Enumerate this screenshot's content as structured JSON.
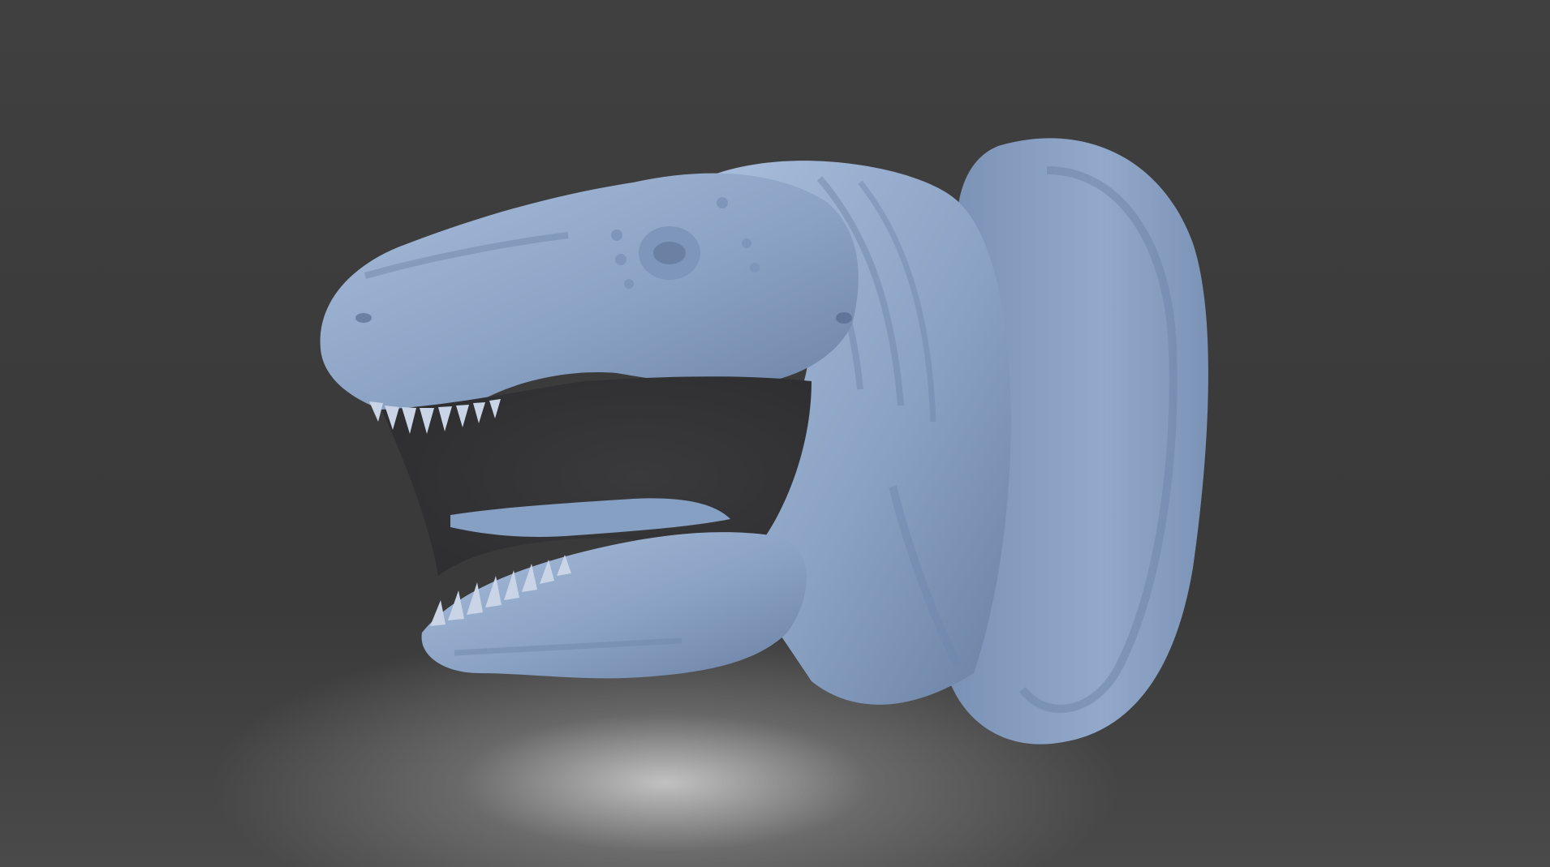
{
  "scene": {
    "background_color": "#3b3b3b",
    "floor_highlight_color": "#d7d7d7",
    "model_color": "#8aa2c4",
    "model_shadow_color": "#6a81a4",
    "model_highlight_color": "#a9bddb",
    "subject_icon": "dinosaur-head-icon"
  }
}
